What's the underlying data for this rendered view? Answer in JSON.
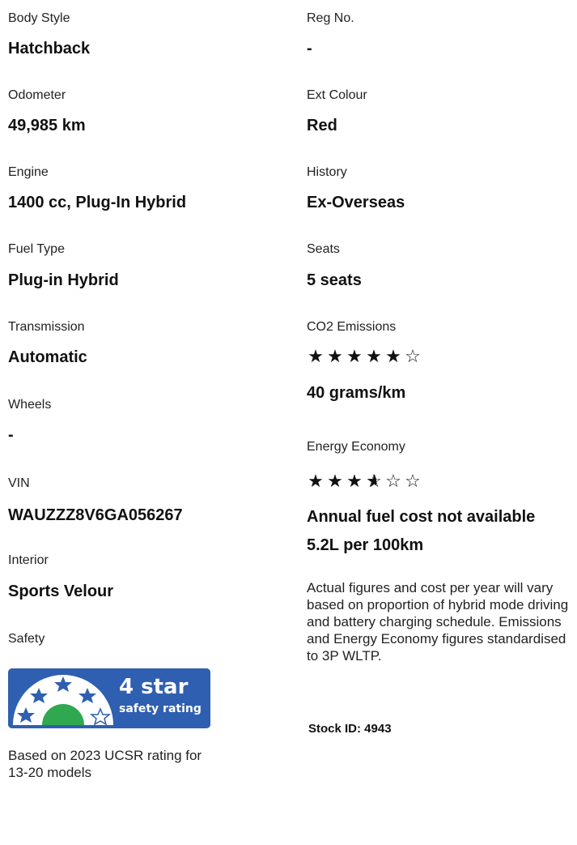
{
  "left": {
    "body_style": {
      "label": "Body Style",
      "value": "Hatchback"
    },
    "odometer": {
      "label": "Odometer",
      "value": "49,985 km"
    },
    "engine": {
      "label": "Engine",
      "value": "1400 cc, Plug-In Hybrid"
    },
    "fuel_type": {
      "label": "Fuel Type",
      "value": "Plug-in Hybrid"
    },
    "transmission": {
      "label": "Transmission",
      "value": "Automatic"
    },
    "wheels": {
      "label": "Wheels",
      "value": "-"
    },
    "vin": {
      "label": "VIN",
      "value": "WAUZZZ8V6GA056267"
    },
    "interior": {
      "label": "Interior",
      "value": "Sports Velour"
    },
    "safety": {
      "label": "Safety",
      "badge_title": "4 star",
      "badge_subtitle": "safety rating",
      "rating": 4,
      "out_of": 5,
      "note": "Based on 2023 UCSR rating for 13-20 models"
    }
  },
  "right": {
    "reg_no": {
      "label": "Reg No.",
      "value": "-"
    },
    "ext_colour": {
      "label": "Ext Colour",
      "value": "Red"
    },
    "history": {
      "label": "History",
      "value": "Ex-Overseas"
    },
    "seats": {
      "label": "Seats",
      "value": "5 seats"
    },
    "co2": {
      "label": "CO2 Emissions",
      "rating": 5,
      "out_of": 6,
      "value": "40 grams/km"
    },
    "energy": {
      "label": "Energy Economy",
      "rating": 3.5,
      "out_of": 6
    },
    "annual_fuel_cost": "Annual fuel cost not available",
    "consumption": "5.2L per 100km",
    "disclaimer": "Actual figures and cost per year will vary based on proportion of hybrid mode driving and battery charging schedule. Emissions and Energy Economy figures standardised to 3P WLTP.",
    "stock_id": "Stock ID: 4943"
  },
  "colors": {
    "badge_blue": "#2f5fb0",
    "badge_green": "#2fa84f"
  }
}
